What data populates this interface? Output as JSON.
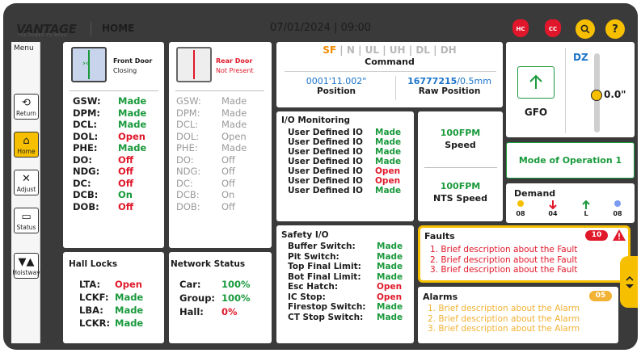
{
  "header": {
    "logo": "VANTAGE",
    "logo_tagline": "THE POWER TO MOVE",
    "page_title": "HOME",
    "datetime": "07/01/2024 | 09:00",
    "hc_badge": "HC",
    "cc_badge": "CC",
    "help_label": "?"
  },
  "sidebar": {
    "menu_label": "Menu",
    "items": [
      {
        "label": "Return",
        "icon": "return-icon"
      },
      {
        "label": "Home",
        "icon": "home-icon",
        "active": true
      },
      {
        "label": "Adjust",
        "icon": "tools-icon"
      },
      {
        "label": "Status",
        "icon": "monitor-icon"
      },
      {
        "label": "Hoistway",
        "icon": "hoistway-icon"
      }
    ]
  },
  "front_door": {
    "title": "Front Door",
    "state": "Closing",
    "rows": [
      {
        "k": "GSW:",
        "v": "Made",
        "c": "green"
      },
      {
        "k": "DPM:",
        "v": "Made",
        "c": "green"
      },
      {
        "k": "DCL:",
        "v": "Made",
        "c": "green"
      },
      {
        "k": "DOL:",
        "v": "Open",
        "c": "red"
      },
      {
        "k": "PHE:",
        "v": "Made",
        "c": "green"
      },
      {
        "k": "DO:",
        "v": "Off",
        "c": "red"
      },
      {
        "k": "NDG:",
        "v": "Off",
        "c": "red"
      },
      {
        "k": "DC:",
        "v": "Off",
        "c": "red"
      },
      {
        "k": "DCB:",
        "v": "On",
        "c": "green"
      },
      {
        "k": "DOB:",
        "v": "Off",
        "c": "red"
      }
    ]
  },
  "rear_door": {
    "title": "Rear Door",
    "state": "Not Present",
    "rows": [
      {
        "k": "GSW:",
        "v": "Made"
      },
      {
        "k": "DPM:",
        "v": "Made"
      },
      {
        "k": "DCL:",
        "v": "Made"
      },
      {
        "k": "DOL:",
        "v": "Open"
      },
      {
        "k": "PHE:",
        "v": "Made"
      },
      {
        "k": "DO:",
        "v": "Off"
      },
      {
        "k": "NDG:",
        "v": "Off"
      },
      {
        "k": "DC:",
        "v": "Off"
      },
      {
        "k": "DCB:",
        "v": "On"
      },
      {
        "k": "DOB:",
        "v": "Off"
      }
    ]
  },
  "command": {
    "modes": [
      "SF",
      "N",
      "UL",
      "UH",
      "DL",
      "DH"
    ],
    "active_mode": "SF",
    "label": "Command",
    "position_value": "0001'11.002\"",
    "position_label": "Position",
    "raw_value": "16777215",
    "raw_unit": "/0.5mm",
    "raw_label": "Raw Position"
  },
  "gfo": {
    "label": "GFO"
  },
  "dz": {
    "label": "DZ",
    "value": "0.0\""
  },
  "mode_of_operation": "Mode of Operation 1",
  "io_monitoring": {
    "title": "I/O Monitoring",
    "rows": [
      {
        "k": "User Defined IO",
        "v": "Made",
        "c": "green"
      },
      {
        "k": "User Defined IO",
        "v": "Made",
        "c": "green"
      },
      {
        "k": "User Defined IO",
        "v": "Made",
        "c": "green"
      },
      {
        "k": "User Defined IO",
        "v": "Made",
        "c": "green"
      },
      {
        "k": "User Defined IO",
        "v": "Open",
        "c": "red"
      },
      {
        "k": "User Defined IO",
        "v": "Open",
        "c": "red"
      },
      {
        "k": "User Defined IO",
        "v": "Made",
        "c": "green"
      }
    ]
  },
  "speed": {
    "value": "100FPM",
    "label": "Speed"
  },
  "nts_speed": {
    "value": "100FPM",
    "label": "NTS Speed"
  },
  "demand": {
    "title": "Demand",
    "items": [
      {
        "label": "08",
        "type": "dot",
        "color": "#f6c000"
      },
      {
        "label": "04",
        "type": "down",
        "color": "#e0192b"
      },
      {
        "label": "L",
        "type": "up",
        "color": "#1a9a3c"
      },
      {
        "label": "08",
        "type": "dot",
        "color": "#7a9cf0"
      }
    ]
  },
  "safety_io": {
    "title": "Safety I/O",
    "rows": [
      {
        "k": "Buffer Switch:",
        "v": "Made",
        "c": "green"
      },
      {
        "k": "Pit Switch:",
        "v": "Made",
        "c": "green"
      },
      {
        "k": "Top Final Limit:",
        "v": "Made",
        "c": "green"
      },
      {
        "k": "Bot Final Limit:",
        "v": "Made",
        "c": "green"
      },
      {
        "k": "Esc Hatch:",
        "v": "Open",
        "c": "red"
      },
      {
        "k": "IC Stop:",
        "v": "Open",
        "c": "red"
      },
      {
        "k": "Firestop Switch:",
        "v": "Made",
        "c": "green"
      },
      {
        "k": "CT Stop Switch:",
        "v": "Made",
        "c": "green"
      }
    ]
  },
  "faults": {
    "title": "Faults",
    "count": "10",
    "items": [
      "1. Brief description about the Fault",
      "2. Brief description about the Fault",
      "3. Brief description about the Fault"
    ]
  },
  "alarms": {
    "title": "Alarms",
    "count": "05",
    "items": [
      "1. Brief description about the Alarm",
      "2. Brief description about the Alarm",
      "3. Brief description about the Alarm"
    ]
  },
  "hall_locks": {
    "title": "Hall Locks",
    "rows": [
      {
        "k": "LTA:",
        "v": "Open",
        "c": "red"
      },
      {
        "k": "LCKF:",
        "v": "Made",
        "c": "green"
      },
      {
        "k": "LBA:",
        "v": "Made",
        "c": "green"
      },
      {
        "k": "LCKR:",
        "v": "Made",
        "c": "green"
      }
    ]
  },
  "network_status": {
    "title": "Network Status",
    "rows": [
      {
        "k": "Car:",
        "v": "100%",
        "c": "green"
      },
      {
        "k": "Group:",
        "v": "100%",
        "c": "green"
      },
      {
        "k": "Hall:",
        "v": "0%",
        "c": "red"
      }
    ]
  },
  "colors": {
    "accent": "#f6c000",
    "green": "#1a9a3c",
    "red": "#e0192b",
    "blue": "#1a73c9",
    "alarm": "#f2b233"
  }
}
